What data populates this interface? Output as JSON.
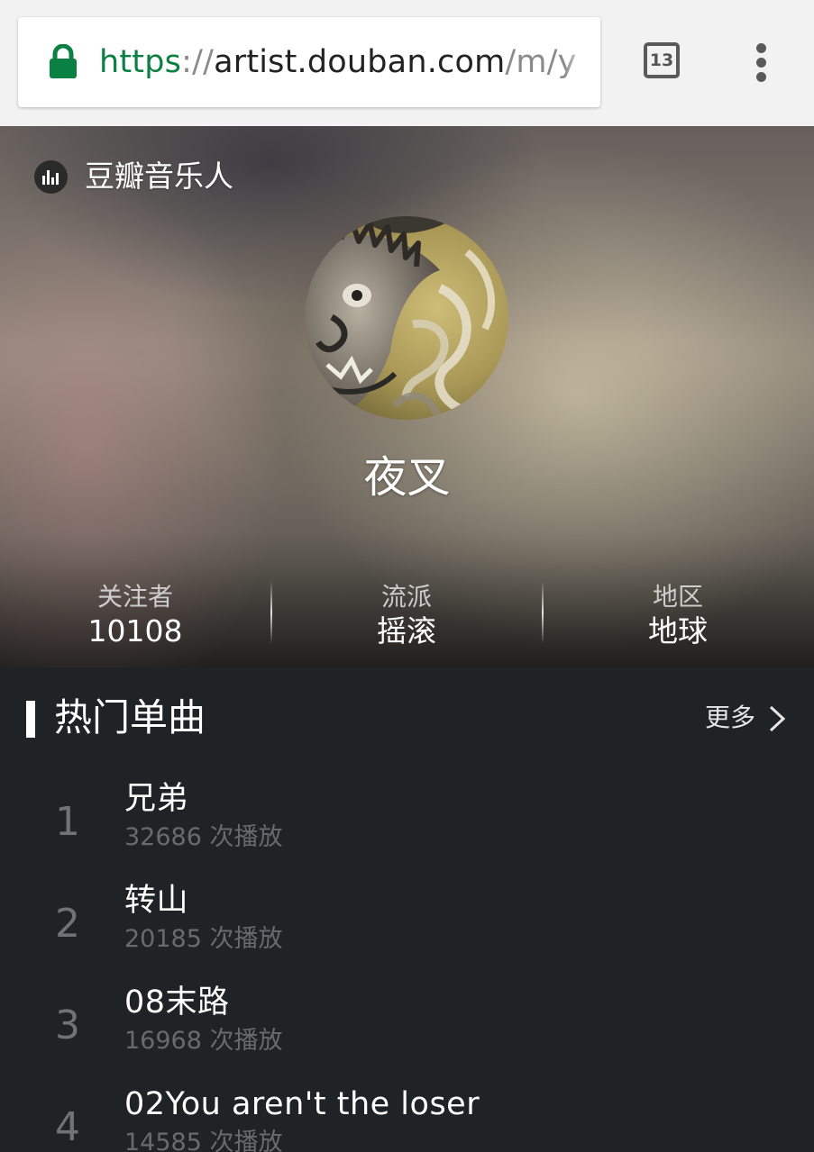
{
  "browser": {
    "url_scheme": "https",
    "url_sep": "://",
    "url_host": "artist.douban.com",
    "url_path": "/m/y",
    "tab_count": "13",
    "colors": {
      "secure": "#0b8043"
    }
  },
  "header": {
    "brand": "豆瓣音乐人"
  },
  "artist": {
    "name": "夜叉"
  },
  "stats": [
    {
      "label": "关注者",
      "value": "10108"
    },
    {
      "label": "流派",
      "value": "摇滚"
    },
    {
      "label": "地区",
      "value": "地球"
    }
  ],
  "hot_songs": {
    "title": "热门单曲",
    "more": "更多",
    "items": [
      {
        "rank": "1",
        "title": "兄弟",
        "plays": "32686 次播放"
      },
      {
        "rank": "2",
        "title": "转山",
        "plays": "20185 次播放"
      },
      {
        "rank": "3",
        "title": "08末路",
        "plays": "16968 次播放"
      },
      {
        "rank": "4",
        "title": "02You aren't the loser",
        "plays": "14585 次播放"
      }
    ]
  },
  "icons": {
    "lock": "lock-icon",
    "tabs": "tab-switcher-icon",
    "menu": "more-vert-icon",
    "brand": "douban-music-logo-icon",
    "more": "chevron-right-icon"
  }
}
